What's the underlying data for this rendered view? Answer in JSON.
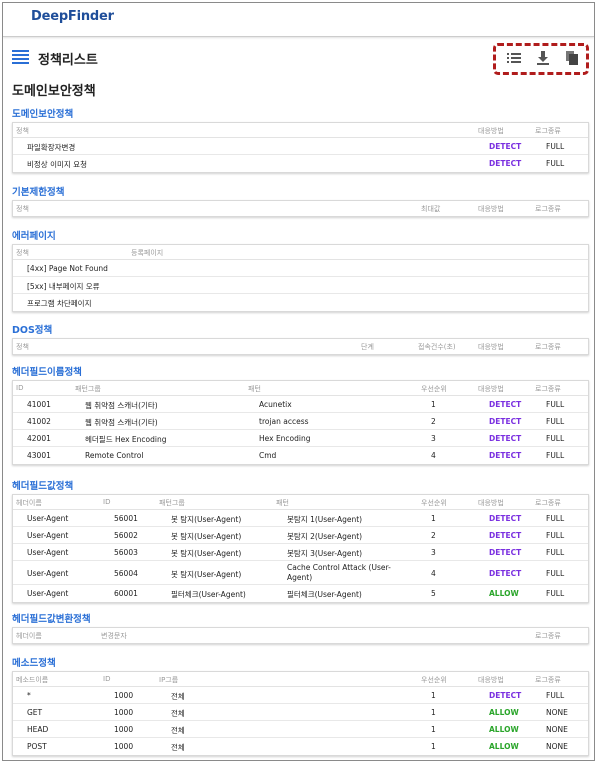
{
  "app": {
    "logo": "DeepFinder"
  },
  "header": {
    "title": "정책리스트"
  },
  "toolbar": {
    "list_icon": "list-icon",
    "download_icon": "download-icon",
    "copy_icon": "copy-icon"
  },
  "colors": {
    "accent": "#2a6fd6",
    "detect": "#7a2fe0",
    "allow": "#2aa52a",
    "highlight": "#b01c1c"
  },
  "main_title": "도메인보안정책",
  "sections": {
    "domain": {
      "title": "도메인보안정책",
      "headers": [
        "정책",
        "대응방법",
        "로그종류"
      ],
      "rows": [
        [
          "파일확장자변경",
          "DETECT",
          "FULL"
        ],
        [
          "비정상 이미지 요청",
          "DETECT",
          "FULL"
        ]
      ]
    },
    "basic": {
      "title": "기본제한정책",
      "headers": [
        "정책",
        "최대값",
        "대응방법",
        "로그종류"
      ]
    },
    "error": {
      "title": "에러페이지",
      "headers": [
        "정책",
        "등록페이지"
      ],
      "rows": [
        [
          "[4xx] Page Not Found"
        ],
        [
          "[5xx] 내부페이지 오류"
        ],
        [
          "프로그램 차단페이지"
        ]
      ]
    },
    "dos": {
      "title": "DOS정책",
      "headers": [
        "정책",
        "단계",
        "접속건수(초)",
        "대응방법",
        "로그종류"
      ]
    },
    "hname": {
      "title": "헤더필드이름정책",
      "headers": [
        "ID",
        "패턴그룹",
        "패턴",
        "우선순위",
        "대응방법",
        "로그종류"
      ],
      "rows": [
        [
          "41001",
          "웹 취약점 스캐너(기타)",
          "Acunetix",
          "1",
          "DETECT",
          "FULL"
        ],
        [
          "41002",
          "웹 취약점 스캐너(기타)",
          "trojan access",
          "2",
          "DETECT",
          "FULL"
        ],
        [
          "42001",
          "헤더필드 Hex Encoding",
          "Hex Encoding",
          "3",
          "DETECT",
          "FULL"
        ],
        [
          "43001",
          "Remote Control",
          "Cmd",
          "4",
          "DETECT",
          "FULL"
        ]
      ]
    },
    "hvalue": {
      "title": "헤더필드값정책",
      "headers": [
        "헤더이름",
        "ID",
        "패턴그룹",
        "패턴",
        "우선순위",
        "대응방법",
        "로그종류"
      ],
      "rows": [
        [
          "User-Agent",
          "56001",
          "봇 탐지(User-Agent)",
          "봇탐지 1(User-Agent)",
          "1",
          "DETECT",
          "FULL"
        ],
        [
          "User-Agent",
          "56002",
          "봇 탐지(User-Agent)",
          "봇탐지 2(User-Agent)",
          "2",
          "DETECT",
          "FULL"
        ],
        [
          "User-Agent",
          "56003",
          "봇 탐지(User-Agent)",
          "봇탐지 3(User-Agent)",
          "3",
          "DETECT",
          "FULL"
        ],
        [
          "User-Agent",
          "56004",
          "봇 탐지(User-Agent)",
          "Cache Control Attack (User-Agent)",
          "4",
          "DETECT",
          "FULL"
        ],
        [
          "User-Agent",
          "60001",
          "필터체크(User-Agent)",
          "필터체크(User-Agent)",
          "5",
          "ALLOW",
          "FULL"
        ]
      ]
    },
    "hchange": {
      "title": "헤더필드값변환정책",
      "headers": [
        "헤더이름",
        "변경문자",
        "로그종류"
      ]
    },
    "method": {
      "title": "메소드정책",
      "headers": [
        "메소드이름",
        "ID",
        "IP그룹",
        "우선순위",
        "대응방법",
        "로그종류"
      ],
      "rows": [
        [
          "*",
          "1000",
          "전체",
          "1",
          "DETECT",
          "FULL"
        ],
        [
          "GET",
          "1000",
          "전체",
          "1",
          "ALLOW",
          "NONE"
        ],
        [
          "HEAD",
          "1000",
          "전체",
          "1",
          "ALLOW",
          "NONE"
        ],
        [
          "POST",
          "1000",
          "전체",
          "1",
          "ALLOW",
          "NONE"
        ]
      ]
    }
  }
}
